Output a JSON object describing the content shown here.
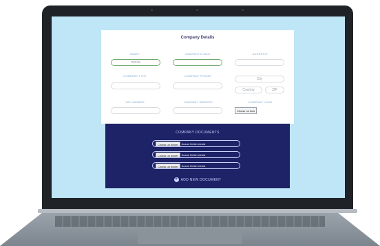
{
  "form": {
    "title": "Company Details",
    "fields": {
      "name": {
        "label": "NAME",
        "required": "*",
        "value": "monia"
      },
      "company_email": {
        "label": "COMPANY E-MAIL",
        "required": "*",
        "value": ""
      },
      "address": {
        "label": "ADDRESS",
        "required": "*",
        "value": ""
      },
      "company_type": {
        "label": "COMPANY TYPE",
        "value": ""
      },
      "company_phone": {
        "label": "COMPANY PHONE",
        "required": "*",
        "value": ""
      },
      "city": {
        "placeholder": "City"
      },
      "country": {
        "placeholder": "Country"
      },
      "zip": {
        "placeholder": "ZIP"
      },
      "vat_number": {
        "label": "VAT NUMBER",
        "value": ""
      },
      "company_website": {
        "label": "COMPANY WEBSITE",
        "value": ""
      },
      "company_logo": {
        "label": "COMPANY LOGO",
        "button": "Choisir un fichi"
      }
    }
  },
  "documents": {
    "title": "COMPANY DOCUMENTS",
    "files": [
      {
        "button": "Choisir un fichier",
        "status": "Aucun fichier choisi"
      },
      {
        "button": "Choisir un fichier",
        "status": "Aucun fichier choisi"
      },
      {
        "button": "Choisir un fichier",
        "status": "Aucun fichier choisi"
      }
    ],
    "add_label": "ADD NEW DOCUMENT",
    "add_icon": "plus-circle-icon"
  }
}
